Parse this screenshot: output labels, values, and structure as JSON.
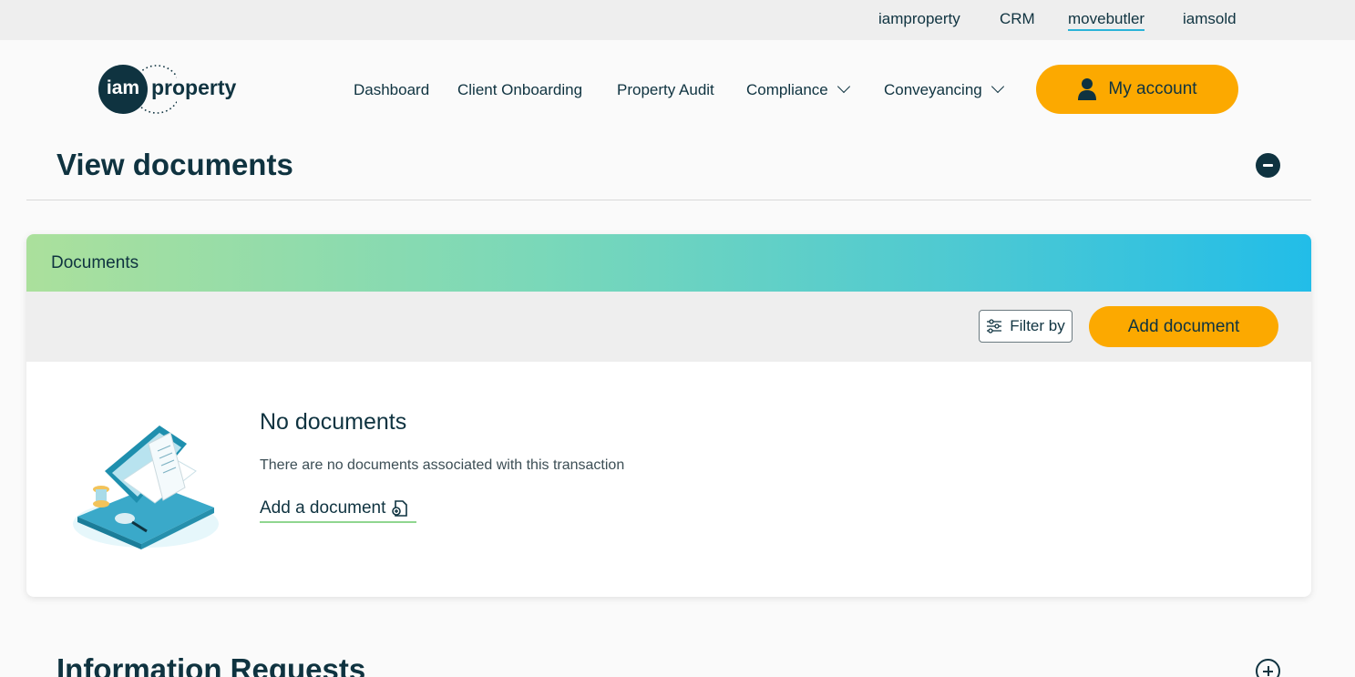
{
  "topbar": {
    "links": [
      "iamproperty",
      "CRM",
      "movebutler",
      "iamsold"
    ],
    "active": "movebutler"
  },
  "logo": {
    "badge": "iam",
    "word": "property"
  },
  "nav": {
    "items": [
      "Dashboard",
      "Client Onboarding",
      "Property Audit",
      "Compliance",
      "Conveyancing"
    ],
    "account": "My account"
  },
  "view_documents": {
    "title": "View documents",
    "card": {
      "header": "Documents",
      "filter_label": "Filter by",
      "add_button": "Add document",
      "empty": {
        "title": "No documents",
        "text": "There are no documents associated with this transaction",
        "link": "Add a document"
      }
    }
  },
  "information_requests": {
    "title": "Information Requests"
  },
  "colors": {
    "brand_dark": "#0f3340",
    "accent_orange": "#fca900",
    "gradient_start": "#abe09c",
    "gradient_end": "#22bde8"
  },
  "icons": [
    "person-icon",
    "chevron-down-icon",
    "filter-sliders-icon",
    "document-add-icon",
    "collapse-minus-icon",
    "expand-plus-icon"
  ]
}
